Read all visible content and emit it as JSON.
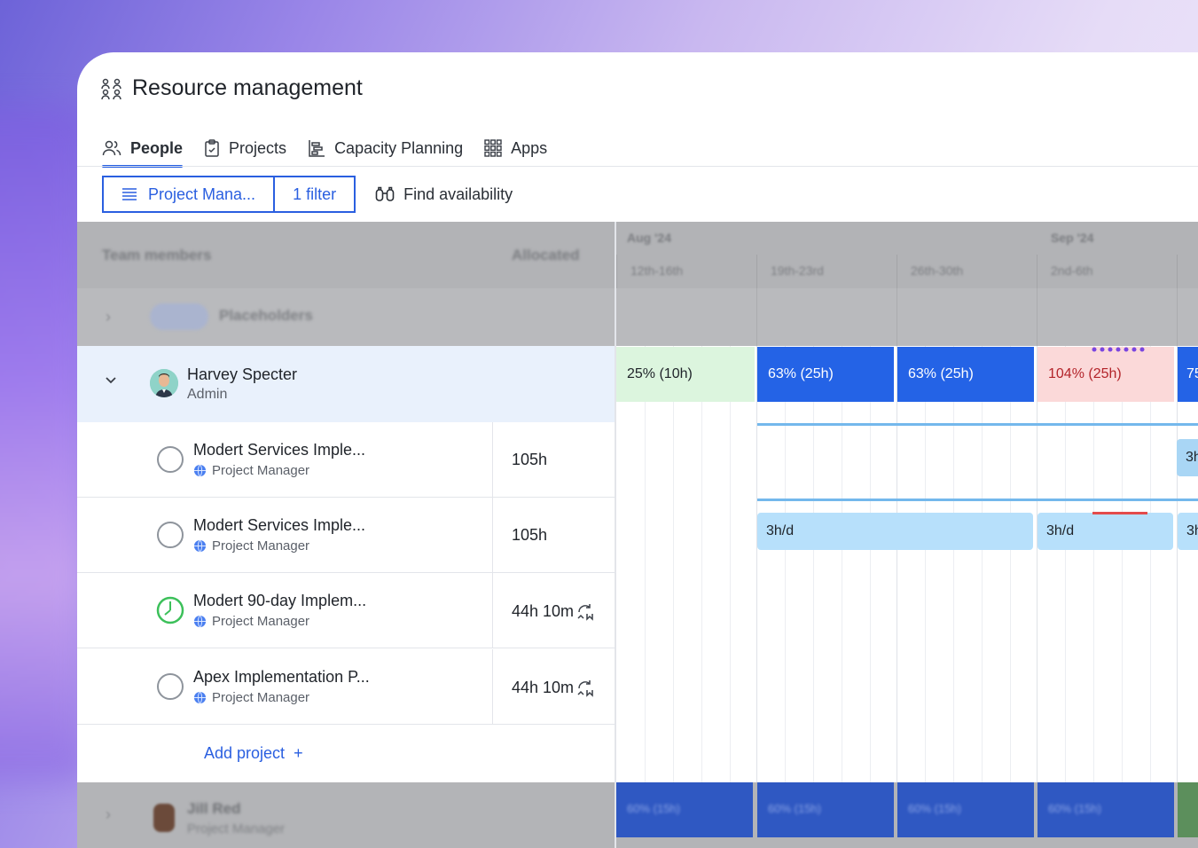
{
  "app": {
    "title": "Resource management",
    "title_icon": "people-group-icon"
  },
  "tabs": [
    {
      "label": "People",
      "icon": "people-icon",
      "active": true
    },
    {
      "label": "Projects",
      "icon": "clipboard-icon",
      "active": false
    },
    {
      "label": "Capacity Planning",
      "icon": "gantt-icon",
      "active": false
    },
    {
      "label": "Apps",
      "icon": "grid-icon",
      "active": false
    }
  ],
  "toolbar": {
    "view_label": "Project Mana...",
    "filter_label": "1 filter",
    "find_label": "Find availability"
  },
  "table": {
    "col_team": "Team members",
    "col_alloc": "Allocated",
    "placeholder_label": "Placeholders"
  },
  "timeline": {
    "months": [
      "Aug '24",
      "Sep '24"
    ],
    "weeks": [
      "12th-16th",
      "19th-23rd",
      "26th-30th",
      "2nd-6th"
    ]
  },
  "person": {
    "name": "Harvey Specter",
    "role": "Admin",
    "capacity": [
      "25% (10h)",
      "63% (25h)",
      "63% (25h)",
      "104% (25h)",
      "75"
    ]
  },
  "projects": [
    {
      "name": "Modert Services Imple...",
      "role": "Project Manager",
      "allocated": "105h",
      "status": "empty"
    },
    {
      "name": "Modert Services Imple...",
      "role": "Project Manager",
      "allocated": "105h",
      "status": "empty"
    },
    {
      "name": "Modert 90-day Implem...",
      "role": "Project Manager",
      "allocated": "44h 10m",
      "status": "partial"
    },
    {
      "name": "Apex Implementation P...",
      "role": "Project Manager",
      "allocated": "44h 10m",
      "status": "empty"
    }
  ],
  "bars": {
    "row1_edge": "3h",
    "row2_a": "3h/d",
    "row2_b": "3h/d",
    "row2_edge": "3h"
  },
  "add_project_label": "Add project",
  "next_person": {
    "name": "Jill Red",
    "role": "Project Manager",
    "capacity": [
      "60% (15h)",
      "60% (15h)",
      "60% (15h)",
      "60% (15h)"
    ]
  },
  "colors": {
    "accent": "#2a5fe0",
    "over_capacity": "#b3242a",
    "under_capacity_bg": "#dcf5de",
    "allocated_bg": "#2463e6",
    "bar_bg": "#b7e0fb"
  }
}
